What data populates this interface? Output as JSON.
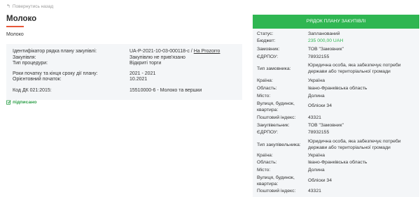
{
  "nav": {
    "back_label": "Повернутись назад"
  },
  "page": {
    "title": "Молоко",
    "subtitle": "Молоко"
  },
  "info": {
    "rows": [
      {
        "label": "Ідентифікатор рядка плану закупівлі:",
        "value": "UA-P-2021-10-03-000118-c /",
        "link": "На Prozorro"
      },
      {
        "label": "Закупівля:",
        "value": "Закупівлю не прив'язано"
      },
      {
        "label": "Тип процедури:",
        "value": "Відкриті торги"
      },
      {
        "label": "Роки початку та кінця сроку дії плану:",
        "value": "2021 - 2021"
      },
      {
        "label": "Орієнтовний початок:",
        "value": "10.2021"
      },
      {
        "label": "Код ДК 021:2015:",
        "value": "15510000-6 - Молоко та вершки"
      }
    ]
  },
  "signed": {
    "label": "підписано",
    "icon": "edit-check-icon"
  },
  "panel": {
    "header": "РЯДОК ПЛАНУ ЗАКУПІВЛІ",
    "accent_color": "#2fb652",
    "rows": [
      {
        "label": "Статус:",
        "value": "Запланований"
      },
      {
        "label": "Бюджет:",
        "value": "235 000,00 UAH"
      },
      {
        "label": "Замовник:",
        "value": "ТОВ \"Замовник\""
      },
      {
        "label": "ЄДРПОУ:",
        "value": "78932155"
      },
      {
        "label": "Тип замовника:",
        "value": "Юридична особа, яка забезпечує потреби держави або територіальної громади"
      },
      {
        "label": "Країна:",
        "value": "Україна"
      },
      {
        "label": "Область:",
        "value": "Івано-Франківська область"
      },
      {
        "label": "Місто:",
        "value": "Долина"
      },
      {
        "label": "Вулиця, будинок, квартира:",
        "value": "Обліски 34"
      },
      {
        "label": "Поштовий індекс:",
        "value": "43321"
      },
      {
        "label": "Закупівельник:",
        "value": "ТОВ \"Замовник\""
      },
      {
        "label": "ЄДРПОУ:",
        "value": "78932155"
      },
      {
        "label": "Тип закупівельника:",
        "value": "Юридична особа, яка забезпечує потреби держави або територіальної громади"
      },
      {
        "label": "Країна:",
        "value": "Україна"
      },
      {
        "label": "Область:",
        "value": "Івано-Франківська область"
      },
      {
        "label": "Місто:",
        "value": "Долина"
      },
      {
        "label": "Вулиця, будинок, квартира:",
        "value": "Обліски 34"
      },
      {
        "label": "Поштовий індекс:",
        "value": "43321"
      }
    ]
  }
}
